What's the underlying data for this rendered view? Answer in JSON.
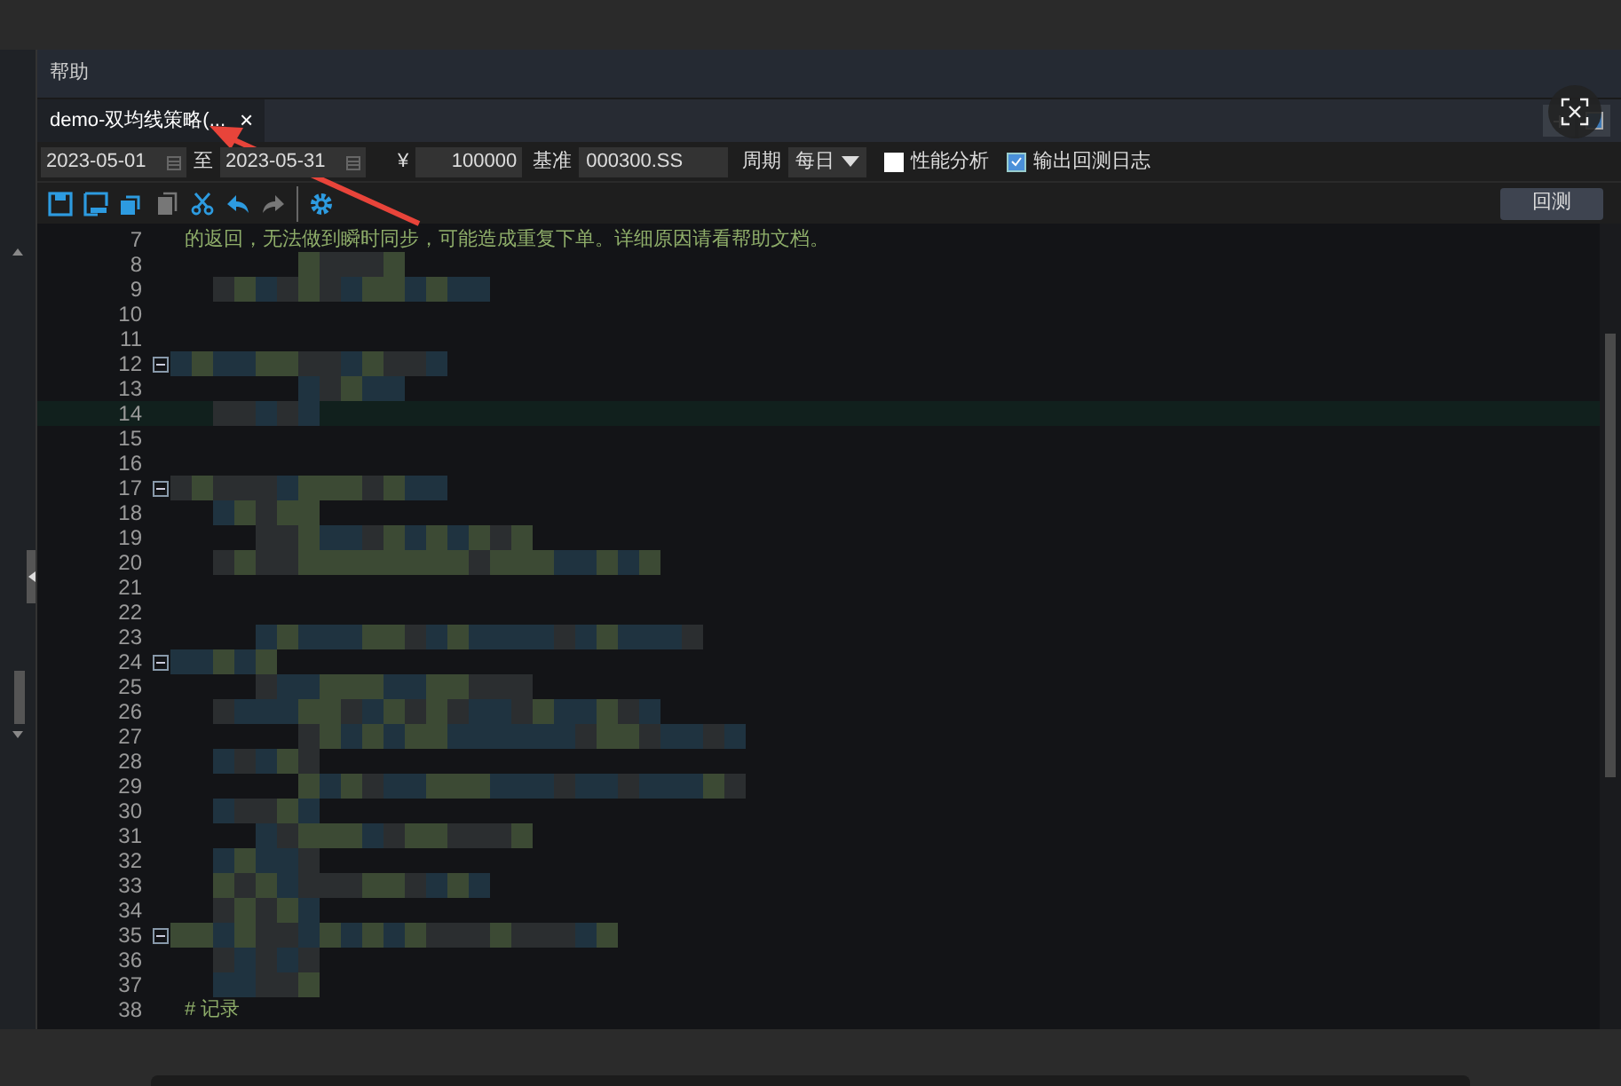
{
  "menu": [
    {
      "label": "帮助"
    }
  ],
  "tabs": [
    {
      "label": "demo-双均线策略(...",
      "close": "×",
      "selected": true
    }
  ],
  "params": {
    "start_date": "2023-05-01",
    "to": "至",
    "end_date": "2023-05-31",
    "currency": "¥",
    "capital": "100000",
    "benchmark_label": "基准",
    "benchmark": "000300.SS",
    "period_label": "周期",
    "period": "每日",
    "options": [
      {
        "label": "性能分析",
        "checked": false
      },
      {
        "label": "输出回测日志",
        "checked": true
      }
    ]
  },
  "run_button": "回测",
  "lines": [
    {
      "number": "7",
      "text": "的返回，无法做到瞬时同步，可能造成重复下单。详细原因请看帮助文档。"
    },
    {
      "number": "8",
      "redacted": true
    },
    {
      "number": "9",
      "redacted": true
    },
    {
      "number": "10"
    },
    {
      "number": "11"
    },
    {
      "number": "12",
      "redacted": true,
      "fold": true
    },
    {
      "number": "13",
      "redacted": true
    },
    {
      "number": "14",
      "redacted": true,
      "current": true
    },
    {
      "number": "15"
    },
    {
      "number": "16"
    },
    {
      "number": "17",
      "redacted": true,
      "fold": true
    },
    {
      "number": "18",
      "redacted": true
    },
    {
      "number": "19",
      "redacted": true
    },
    {
      "number": "20",
      "redacted": true
    },
    {
      "number": "21"
    },
    {
      "number": "22"
    },
    {
      "number": "23",
      "redacted": true
    },
    {
      "number": "24",
      "redacted": true,
      "fold": true
    },
    {
      "number": "25",
      "redacted": true
    },
    {
      "number": "26",
      "redacted": true
    },
    {
      "number": "27",
      "redacted": true
    },
    {
      "number": "28",
      "redacted": true
    },
    {
      "number": "29",
      "redacted": true
    },
    {
      "number": "30",
      "redacted": true
    },
    {
      "number": "31",
      "redacted": true
    },
    {
      "number": "32",
      "redacted": true
    },
    {
      "number": "33",
      "redacted": true
    },
    {
      "number": "34",
      "redacted": true
    },
    {
      "number": "35",
      "redacted": true,
      "fold": true
    },
    {
      "number": "36",
      "redacted": true
    },
    {
      "number": "37",
      "redacted": true
    },
    {
      "number": "38",
      "text": "# 记录"
    }
  ],
  "annotations": [
    {
      "kind": "arrow"
    }
  ]
}
